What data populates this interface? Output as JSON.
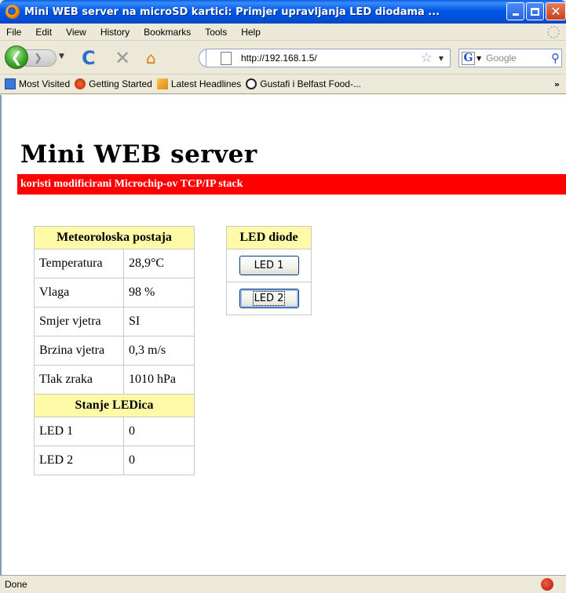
{
  "window": {
    "title": "Mini WEB server na microSD kartici: Primjer upravljanja LED diodama ...",
    "min_glyph": "_",
    "close_glyph": "✕"
  },
  "menubar": {
    "items": [
      "File",
      "Edit",
      "View",
      "History",
      "Bookmarks",
      "Tools",
      "Help"
    ]
  },
  "navbar": {
    "back_glyph": "❮",
    "forward_glyph": "❯",
    "dropdown_glyph": "▼",
    "reload_glyph": "C",
    "stop_glyph": "✕",
    "home_glyph": "⌂",
    "url": "http://192.168.1.5/",
    "star_glyph": "☆",
    "search_engine_glyph": "G",
    "search_placeholder": "Google",
    "search_glyph": "⚲"
  },
  "bookmarks": {
    "items": [
      "Most Visited",
      "Getting Started",
      "Latest Headlines",
      "Gustafi i Belfast Food-..."
    ],
    "chevron": "»"
  },
  "page": {
    "title": "Mini WEB server",
    "subtitle": "koristi modificirani Microchip-ov TCP/IP stack",
    "meteo": {
      "header": "Meteoroloska postaja",
      "rows": [
        {
          "label": "Temperatura",
          "value": "28,9°C"
        },
        {
          "label": "Vlaga",
          "value": "98 %"
        },
        {
          "label": "Smjer vjetra",
          "value": "SI"
        },
        {
          "label": "Brzina vjetra",
          "value": "0,3 m/s"
        },
        {
          "label": "Tlak zraka",
          "value": "1010 hPa"
        }
      ],
      "led_header": "Stanje LEDica",
      "led_rows": [
        {
          "label": "LED 1",
          "value": "0"
        },
        {
          "label": "LED 2",
          "value": "0"
        }
      ]
    },
    "led_panel": {
      "header": "LED diode",
      "buttons": [
        "LED 1",
        "LED 2"
      ]
    }
  },
  "statusbar": {
    "text": "Done"
  },
  "colors": {
    "red_bar": "#ff0000",
    "table_header": "#fefaa8",
    "titlebar": "#0058e6"
  }
}
